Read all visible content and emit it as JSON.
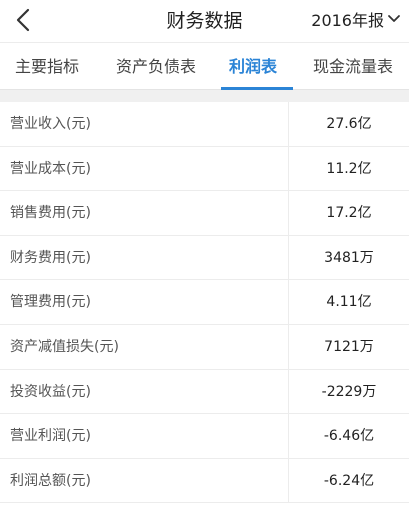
{
  "header": {
    "title": "财务数据",
    "period_selector": "2016年报",
    "icons": {
      "back": "back-arrow-icon",
      "period": "chevron-down-icon"
    }
  },
  "tabs": [
    {
      "label": "主要指标",
      "active": false
    },
    {
      "label": "资产负债表",
      "active": false
    },
    {
      "label": "利润表",
      "active": true
    },
    {
      "label": "现金流量表",
      "active": false
    }
  ],
  "colors": {
    "accent": "#2b84d6",
    "background_gap": "#f0f0f0"
  },
  "rows": [
    {
      "label": "营业收入(元)",
      "value": "27.6亿"
    },
    {
      "label": "营业成本(元)",
      "value": "11.2亿"
    },
    {
      "label": "销售费用(元)",
      "value": "17.2亿"
    },
    {
      "label": "财务费用(元)",
      "value": "3481万"
    },
    {
      "label": "管理费用(元)",
      "value": "4.11亿"
    },
    {
      "label": "资产减值损失(元)",
      "value": "7121万"
    },
    {
      "label": "投资收益(元)",
      "value": "-2229万"
    },
    {
      "label": "营业利润(元)",
      "value": "-6.46亿"
    },
    {
      "label": "利润总额(元)",
      "value": "-6.24亿"
    }
  ]
}
